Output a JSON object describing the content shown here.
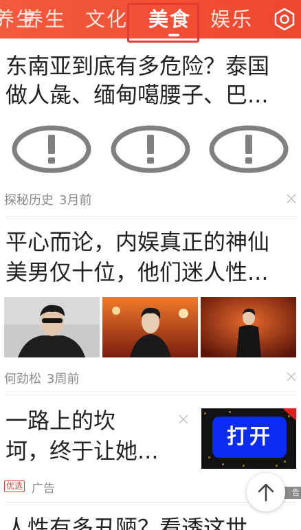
{
  "nav": {
    "tabs": [
      {
        "label": "养生"
      },
      {
        "label": "文化"
      },
      {
        "label": "美食",
        "active": true
      },
      {
        "label": "娱乐"
      }
    ],
    "settings_icon": "gear-hex-icon",
    "accent": "#f0472f"
  },
  "article1": {
    "line1": "东南亚到底有多危险？泰国",
    "line2": "做人彘、缅甸噶腰子、巴...",
    "images": [
      "broken-image-icon",
      "broken-image-icon",
      "broken-image-icon"
    ],
    "source": "探秘历史",
    "time": "3月前"
  },
  "article2": {
    "line1": "平心而论，内娱真正的神仙",
    "line2": "美男仅十位，他们迷人性...",
    "source": "何劲松",
    "time": "3周前"
  },
  "ad": {
    "line1": "一路上的坎",
    "line2": "坷，终于让她...",
    "button_label": "打开",
    "tag": "优选",
    "label": "广告",
    "corner": "告"
  },
  "article3": {
    "line1": "人性有多丑陋？看透这世"
  }
}
